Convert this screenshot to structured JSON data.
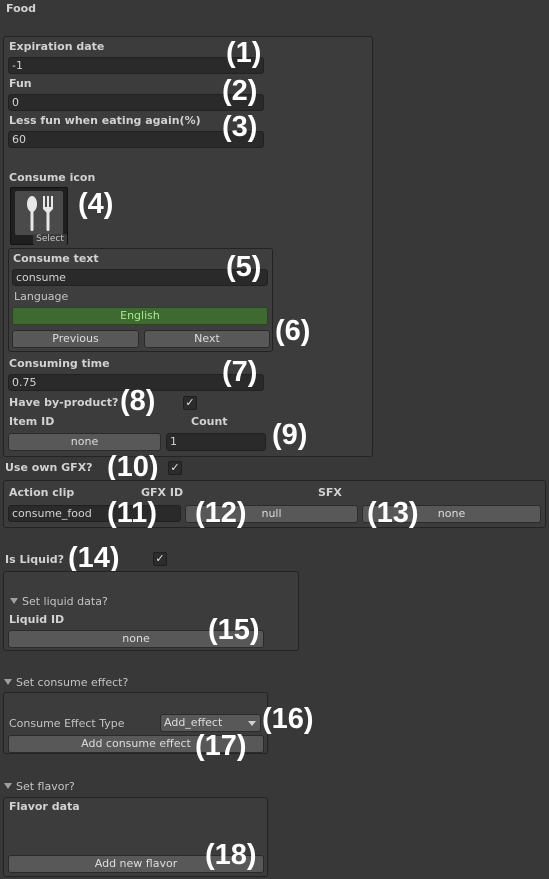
{
  "header": {
    "title": "Food"
  },
  "expiration": {
    "label": "Expiration date",
    "value": "-1",
    "marker": "(1)"
  },
  "fun": {
    "label": "Fun",
    "value": "0",
    "marker": "(2)"
  },
  "less_fun": {
    "label": "Less fun when eating again(%)",
    "value": "60",
    "marker": "(3)"
  },
  "consume_icon": {
    "label": "Consume icon",
    "select_label": "Select",
    "icon": "spoon-fork-icon",
    "marker": "(4)"
  },
  "consume_text": {
    "label": "Consume text",
    "value": "consume",
    "marker": "(5)"
  },
  "language": {
    "label": "Language",
    "value": "English",
    "previous": "Previous",
    "next": "Next",
    "marker": "(6)"
  },
  "consuming_time": {
    "label": "Consuming time",
    "value": "0.75",
    "marker": "(7)"
  },
  "by_product": {
    "label": "Have by-product?",
    "checked": true,
    "marker": "(8)",
    "item_id_label": "Item ID",
    "item_id_value": "none",
    "count_label": "Count",
    "count_value": "1",
    "count_marker": "(9)"
  },
  "own_gfx": {
    "label": "Use own GFX?",
    "checked": true,
    "marker": "(10)"
  },
  "action_clip": {
    "label": "Action clip",
    "value": "consume_food",
    "marker": "(11)",
    "gfx_label": "GFX ID",
    "gfx_value": "null",
    "gfx_marker": "(12)",
    "sfx_label": "SFX",
    "sfx_value": "none",
    "sfx_marker": "(13)"
  },
  "liquid": {
    "label": "Is Liquid?",
    "checked": true,
    "marker": "(14)",
    "foldout": "Set liquid data?",
    "id_label": "Liquid ID",
    "id_value": "none",
    "id_marker": "(15)"
  },
  "consume_effect": {
    "foldout": "Set consume effect?",
    "type_label": "Consume Effect Type",
    "type_value": "Add_effect",
    "type_marker": "(16)",
    "add_button": "Add consume effect",
    "add_marker": "(17)"
  },
  "flavor": {
    "foldout": "Set flavor?",
    "data_label": "Flavor data",
    "add_button": "Add new flavor",
    "marker": "(18)"
  },
  "colors": {
    "background": "#383838",
    "field": "#2a2a2a",
    "button": "#585858",
    "language_button": "#3e6a32",
    "language_text": "#a8e88e",
    "annotation": "#ffffff"
  }
}
